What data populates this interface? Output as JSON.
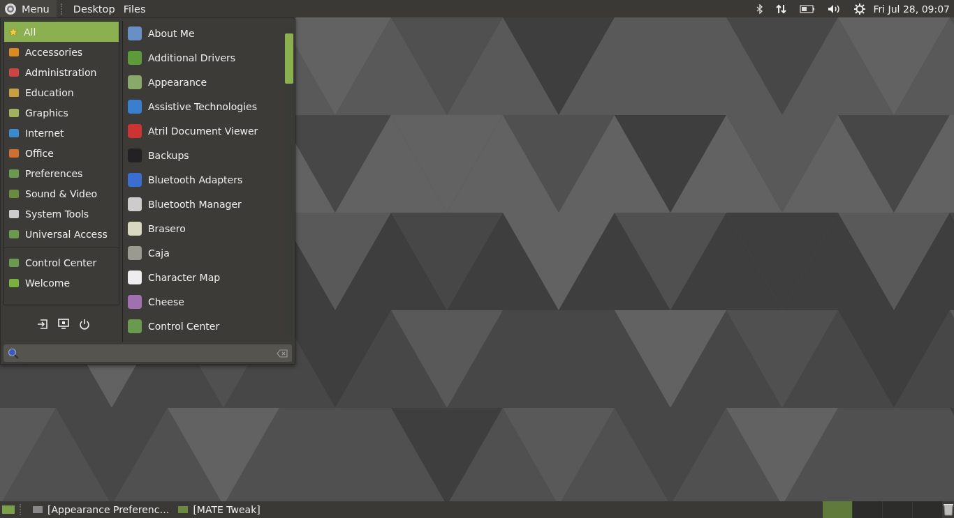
{
  "top_panel": {
    "menu_button": "Menu",
    "menus": [
      "Desktop",
      "Files"
    ],
    "clock": "Fri Jul 28, 09:07"
  },
  "menu": {
    "categories": [
      {
        "label": "All",
        "selected": true
      },
      {
        "label": "Accessories",
        "selected": false
      },
      {
        "label": "Administration",
        "selected": false
      },
      {
        "label": "Education",
        "selected": false
      },
      {
        "label": "Graphics",
        "selected": false
      },
      {
        "label": "Internet",
        "selected": false
      },
      {
        "label": "Office",
        "selected": false
      },
      {
        "label": "Preferences",
        "selected": false
      },
      {
        "label": "Sound & Video",
        "selected": false
      },
      {
        "label": "System Tools",
        "selected": false
      },
      {
        "label": "Universal Access",
        "selected": false
      }
    ],
    "places": [
      "Control Center",
      "Welcome"
    ],
    "apps": [
      "About Me",
      "Additional Drivers",
      "Appearance",
      "Assistive Technologies",
      "Atril Document Viewer",
      "Backups",
      "Bluetooth Adapters",
      "Bluetooth Manager",
      "Brasero",
      "Caja",
      "Character Map",
      "Cheese",
      "Control Center"
    ]
  },
  "taskbar": {
    "windows": [
      "[Appearance Preferenc…",
      "[MATE Tweak]"
    ],
    "workspaces": [
      {
        "selected": true
      },
      {
        "selected": false
      },
      {
        "selected": false
      },
      {
        "selected": false
      }
    ]
  }
}
